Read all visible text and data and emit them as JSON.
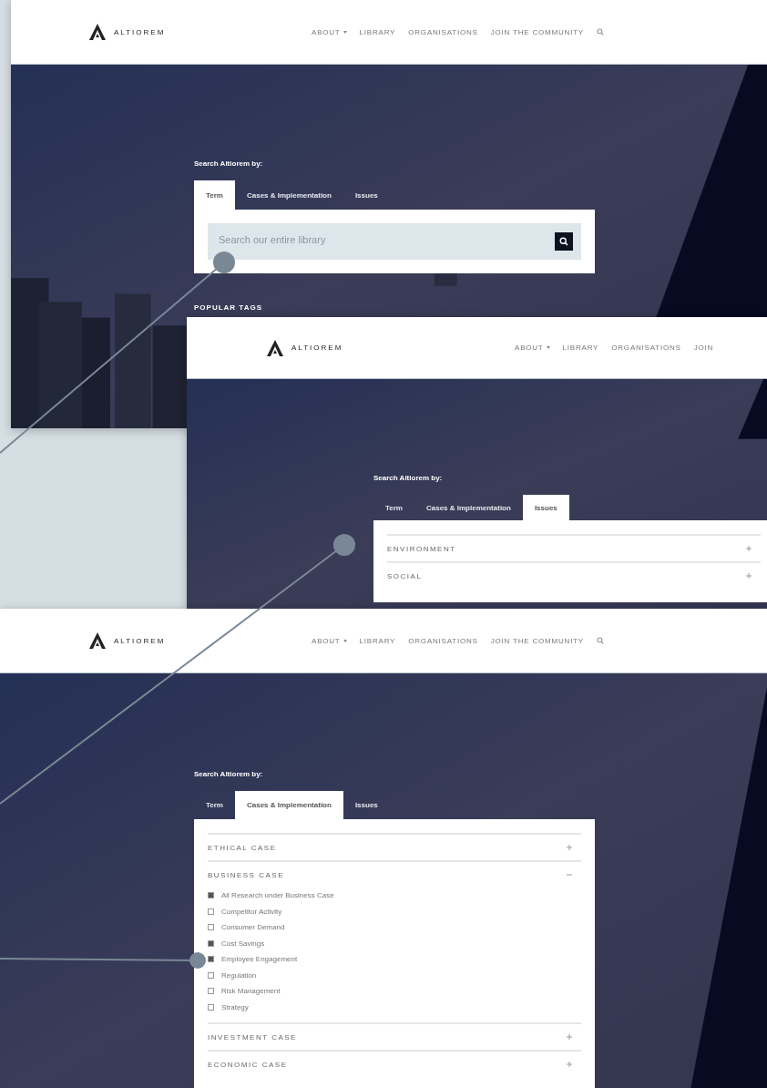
{
  "screens": [
    {
      "kind": "search",
      "logo": "ALTIOREM",
      "nav": [
        {
          "label": "ABOUT",
          "dropdown": true
        },
        {
          "label": "LIBRARY",
          "dropdown": false
        },
        {
          "label": "ORGANISATIONS",
          "dropdown": false
        },
        {
          "label": "JOIN THE COMMUNITY",
          "dropdown": false
        }
      ],
      "search_button": true,
      "heading": "Search Altiorem by:",
      "tabs": [
        {
          "label": "Term",
          "selected": true
        },
        {
          "label": "Cases & Implementation",
          "selected": false
        },
        {
          "label": "Issues",
          "selected": false
        }
      ],
      "search": {
        "placeholder": "Search our entire library"
      },
      "section_label": "POPULAR TAGS"
    },
    {
      "kind": "accordion",
      "logo": "ALTIOREM",
      "nav": [
        {
          "label": "ABOUT",
          "dropdown": true
        },
        {
          "label": "LIBRARY",
          "dropdown": false
        },
        {
          "label": "ORGANISATIONS",
          "dropdown": false
        },
        {
          "label": "JOIN",
          "dropdown": false
        }
      ],
      "search_button": false,
      "heading": "Search Altiorem by:",
      "tabs": [
        {
          "label": "Term",
          "selected": false
        },
        {
          "label": "Cases & Implementation",
          "selected": false
        },
        {
          "label": "Issues",
          "selected": true
        }
      ],
      "sections": [
        {
          "label": "ENVIRONMENT",
          "expanded": false
        },
        {
          "label": "SOCIAL",
          "expanded": false
        }
      ]
    },
    {
      "kind": "accordion",
      "logo": "ALTIOREM",
      "nav": [
        {
          "label": "ABOUT",
          "dropdown": true
        },
        {
          "label": "LIBRARY",
          "dropdown": false
        },
        {
          "label": "ORGANISATIONS",
          "dropdown": false
        },
        {
          "label": "JOIN THE COMMUNITY",
          "dropdown": false
        }
      ],
      "search_button": true,
      "heading": "Search Altiorem by:",
      "tabs": [
        {
          "label": "Term",
          "selected": false
        },
        {
          "label": "Cases & Implementation",
          "selected": true
        },
        {
          "label": "Issues",
          "selected": false
        }
      ],
      "sections": [
        {
          "label": "ETHICAL CASE",
          "expanded": false
        },
        {
          "label": "BUSINESS CASE",
          "expanded": true,
          "items": [
            {
              "label": "All Research under Business Case",
              "checked": true
            },
            {
              "label": "Competitor Activity",
              "checked": false
            },
            {
              "label": "Consumer Demand",
              "checked": false
            },
            {
              "label": "Cost Savings",
              "checked": true
            },
            {
              "label": "Employee Engagement",
              "checked": true
            },
            {
              "label": "Regulation",
              "checked": false
            },
            {
              "label": "Risk Management",
              "checked": false
            },
            {
              "label": "Strategy",
              "checked": false
            }
          ]
        },
        {
          "label": "INVESTMENT CASE",
          "expanded": false
        },
        {
          "label": "ECONOMIC CASE",
          "expanded": false
        }
      ]
    }
  ]
}
